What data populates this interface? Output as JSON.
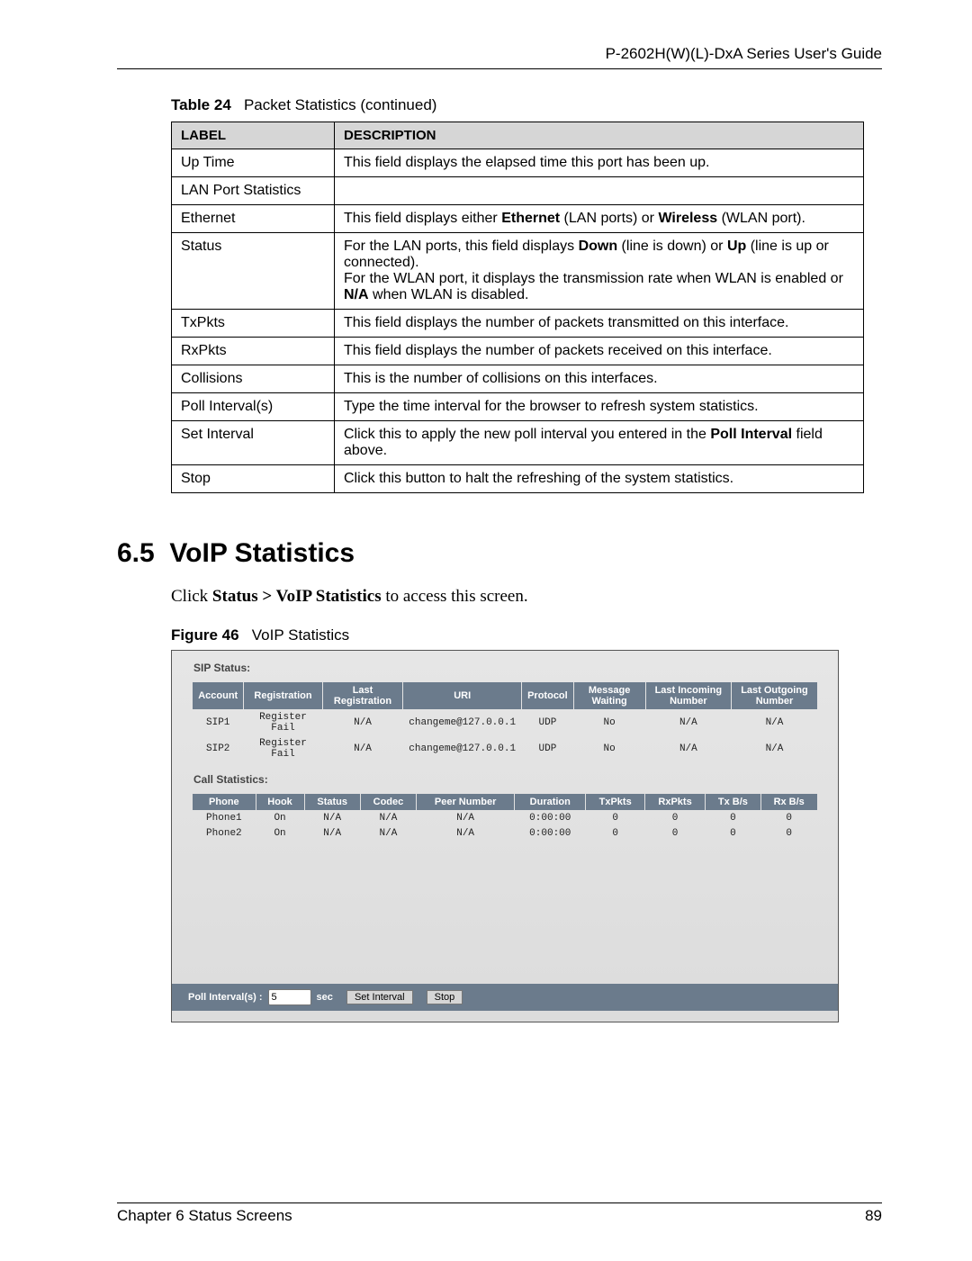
{
  "header": {
    "guide_title": "P-2602H(W)(L)-DxA Series User's Guide"
  },
  "table24": {
    "caption_prefix": "Table 24",
    "caption_text": "Packet Statistics (continued)",
    "head_label": "LABEL",
    "head_desc": "DESCRIPTION",
    "rows": [
      {
        "label": "Up Time",
        "desc": "This field displays the elapsed time this port has been up."
      },
      {
        "label": "LAN Port Statistics",
        "desc": ""
      },
      {
        "label": "Ethernet",
        "desc_html": "This field displays either <b>Ethernet</b> (LAN ports) or <b>Wireless</b> (WLAN port)."
      },
      {
        "label": "Status",
        "desc_html": "For the LAN ports, this field displays <b>Down</b> (line is down) or <b>Up</b> (line is up or connected).<br>For the WLAN port, it displays the transmission rate when WLAN is enabled or <b>N/A</b> when WLAN is disabled."
      },
      {
        "label": "TxPkts",
        "desc": "This field displays the number of packets transmitted on this interface."
      },
      {
        "label": "RxPkts",
        "desc": "This field displays the number of packets received on this interface."
      },
      {
        "label": "Collisions",
        "desc": "This is the number of collisions on this interfaces."
      },
      {
        "label": "Poll Interval(s)",
        "desc": "Type the time interval for the browser to refresh system statistics."
      },
      {
        "label": "Set Interval",
        "desc_html": "Click this to apply the new poll interval you entered in the <b>Poll Interval</b> field above."
      },
      {
        "label": "Stop",
        "desc": "Click this button to halt the refreshing of the system statistics."
      }
    ]
  },
  "section": {
    "number": "6.5",
    "title": "VoIP Statistics",
    "para_prefix": "Click ",
    "para_bold": "Status > VoIP Statistics",
    "para_suffix": " to access this screen."
  },
  "figure46": {
    "caption_prefix": "Figure 46",
    "caption_text": "VoIP Statistics",
    "sip_status_label": "SIP Status:",
    "call_stats_label": "Call Statistics:",
    "sip_headers": [
      "Account",
      "Registration",
      "Last Registration",
      "URI",
      "Protocol",
      "Message Waiting",
      "Last Incoming Number",
      "Last Outgoing Number"
    ],
    "sip_rows": [
      [
        "SIP1",
        "Register Fail",
        "N/A",
        "changeme@127.0.0.1",
        "UDP",
        "No",
        "N/A",
        "N/A"
      ],
      [
        "SIP2",
        "Register Fail",
        "N/A",
        "changeme@127.0.0.1",
        "UDP",
        "No",
        "N/A",
        "N/A"
      ]
    ],
    "call_headers": [
      "Phone",
      "Hook",
      "Status",
      "Codec",
      "Peer Number",
      "Duration",
      "TxPkts",
      "RxPkts",
      "Tx B/s",
      "Rx B/s"
    ],
    "call_rows": [
      [
        "Phone1",
        "On",
        "N/A",
        "N/A",
        "N/A",
        "0:00:00",
        "0",
        "0",
        "0",
        "0"
      ],
      [
        "Phone2",
        "On",
        "N/A",
        "N/A",
        "N/A",
        "0:00:00",
        "0",
        "0",
        "0",
        "0"
      ]
    ],
    "poll_label": "Poll Interval(s) :",
    "poll_value": "5",
    "poll_unit": "sec",
    "set_interval_btn": "Set Interval",
    "stop_btn": "Stop"
  },
  "footer": {
    "chapter": "Chapter 6 Status Screens",
    "page": "89"
  }
}
